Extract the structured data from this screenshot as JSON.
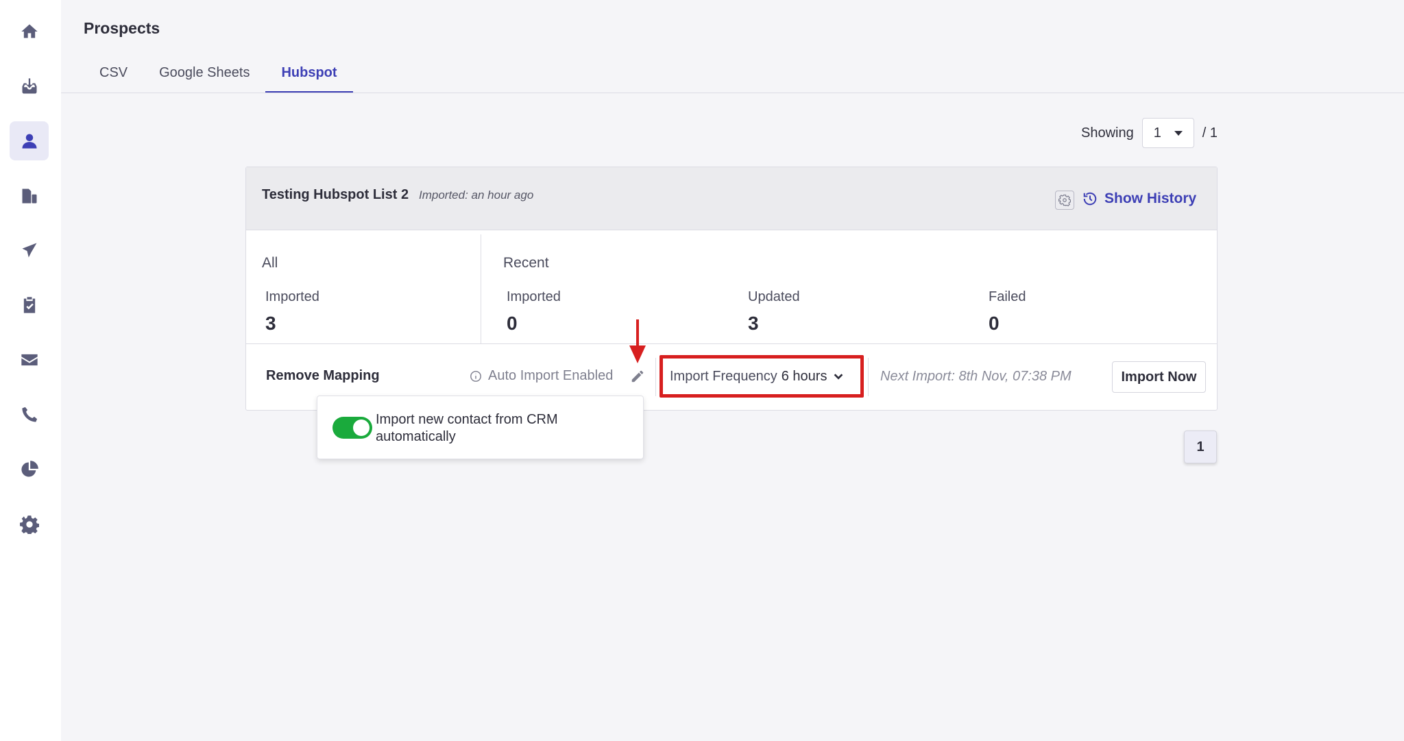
{
  "sidebar": {
    "items": [
      {
        "icon": "home-icon"
      },
      {
        "icon": "inbox-download-icon"
      },
      {
        "icon": "user-icon",
        "active": true
      },
      {
        "icon": "documents-icon"
      },
      {
        "icon": "paper-plane-icon"
      },
      {
        "icon": "clipboard-check-icon"
      },
      {
        "icon": "envelope-icon"
      },
      {
        "icon": "phone-icon"
      },
      {
        "icon": "pie-chart-icon"
      },
      {
        "icon": "gear-icon"
      }
    ]
  },
  "header": {
    "title": "Prospects",
    "tabs": [
      {
        "label": "CSV"
      },
      {
        "label": "Google Sheets"
      },
      {
        "label": "Hubspot",
        "active": true
      }
    ]
  },
  "showing": {
    "label": "Showing",
    "current": "1",
    "total": "/ 1"
  },
  "card": {
    "list_name": "Testing Hubspot List 2",
    "imported_ago": "Imported: an hour ago",
    "show_history": "Show History",
    "all": {
      "label": "All",
      "imported_label": "Imported",
      "imported_value": "3"
    },
    "recent": {
      "label": "Recent",
      "imported_label": "Imported",
      "imported_value": "0",
      "updated_label": "Updated",
      "updated_value": "3",
      "failed_label": "Failed",
      "failed_value": "0"
    },
    "actions": {
      "remove_mapping": "Remove Mapping",
      "auto_import": "Auto Import Enabled",
      "frequency_label": "Import Frequency",
      "frequency_value": "6 hours",
      "next_import": "Next Import: 8th Nov, 07:38 PM",
      "import_now": "Import Now"
    }
  },
  "popover": {
    "text": "Import new contact from CRM automatically",
    "toggle_on": true
  },
  "pagination": {
    "current": "1"
  },
  "colors": {
    "accent": "#3d3fb5",
    "highlight_box": "#d71f1f",
    "toggle_on": "#1aaa3c"
  }
}
